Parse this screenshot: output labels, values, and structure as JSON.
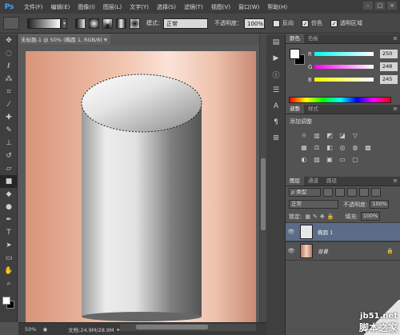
{
  "menu": {
    "app": "Ps",
    "items": [
      "文件(F)",
      "编辑(E)",
      "图像(I)",
      "图层(L)",
      "文字(Y)",
      "选择(S)",
      "滤镜(T)",
      "视图(V)",
      "窗口(W)",
      "帮助(H)"
    ]
  },
  "options": {
    "mode_label": "模式：",
    "mode_value": "正常",
    "opacity_label": "不透明度：",
    "opacity_value": "100%",
    "reverse_label": "反向",
    "dither_label": "仿色",
    "transparency_label": "透明区域"
  },
  "document": {
    "tab_title": "未标题-1 @ 50% (椭圆 1, RGB/8) *",
    "zoom": "50%",
    "doc_info": "文档:24.9M/28.9M"
  },
  "color_panel": {
    "tabs": [
      "颜色",
      "色板"
    ],
    "r_label": "R",
    "r_value": "250",
    "g_label": "G",
    "g_value": "248",
    "b_label": "B",
    "b_value": "245"
  },
  "adjust_panel": {
    "tabs": [
      "调整",
      "样式"
    ],
    "title": "添加调整"
  },
  "layers_panel": {
    "tabs": [
      "图层",
      "通道",
      "路径"
    ],
    "filter": "ρ 类型",
    "blend_mode": "正常",
    "opacity_label": "不透明度:",
    "opacity_value": "100%",
    "lock_label": "锁定:",
    "fill_label": "填充:",
    "fill_value": "100%",
    "layers": [
      {
        "name": "椭圆 1",
        "selected": true
      },
      {
        "name": "背景",
        "selected": false
      }
    ]
  },
  "watermark": {
    "url": "jb51.net",
    "text": "脚本之家"
  },
  "colors": {
    "selection": "#5b6d86",
    "canvas_light": "#fbe2d7",
    "canvas_dark": "#d99479"
  }
}
